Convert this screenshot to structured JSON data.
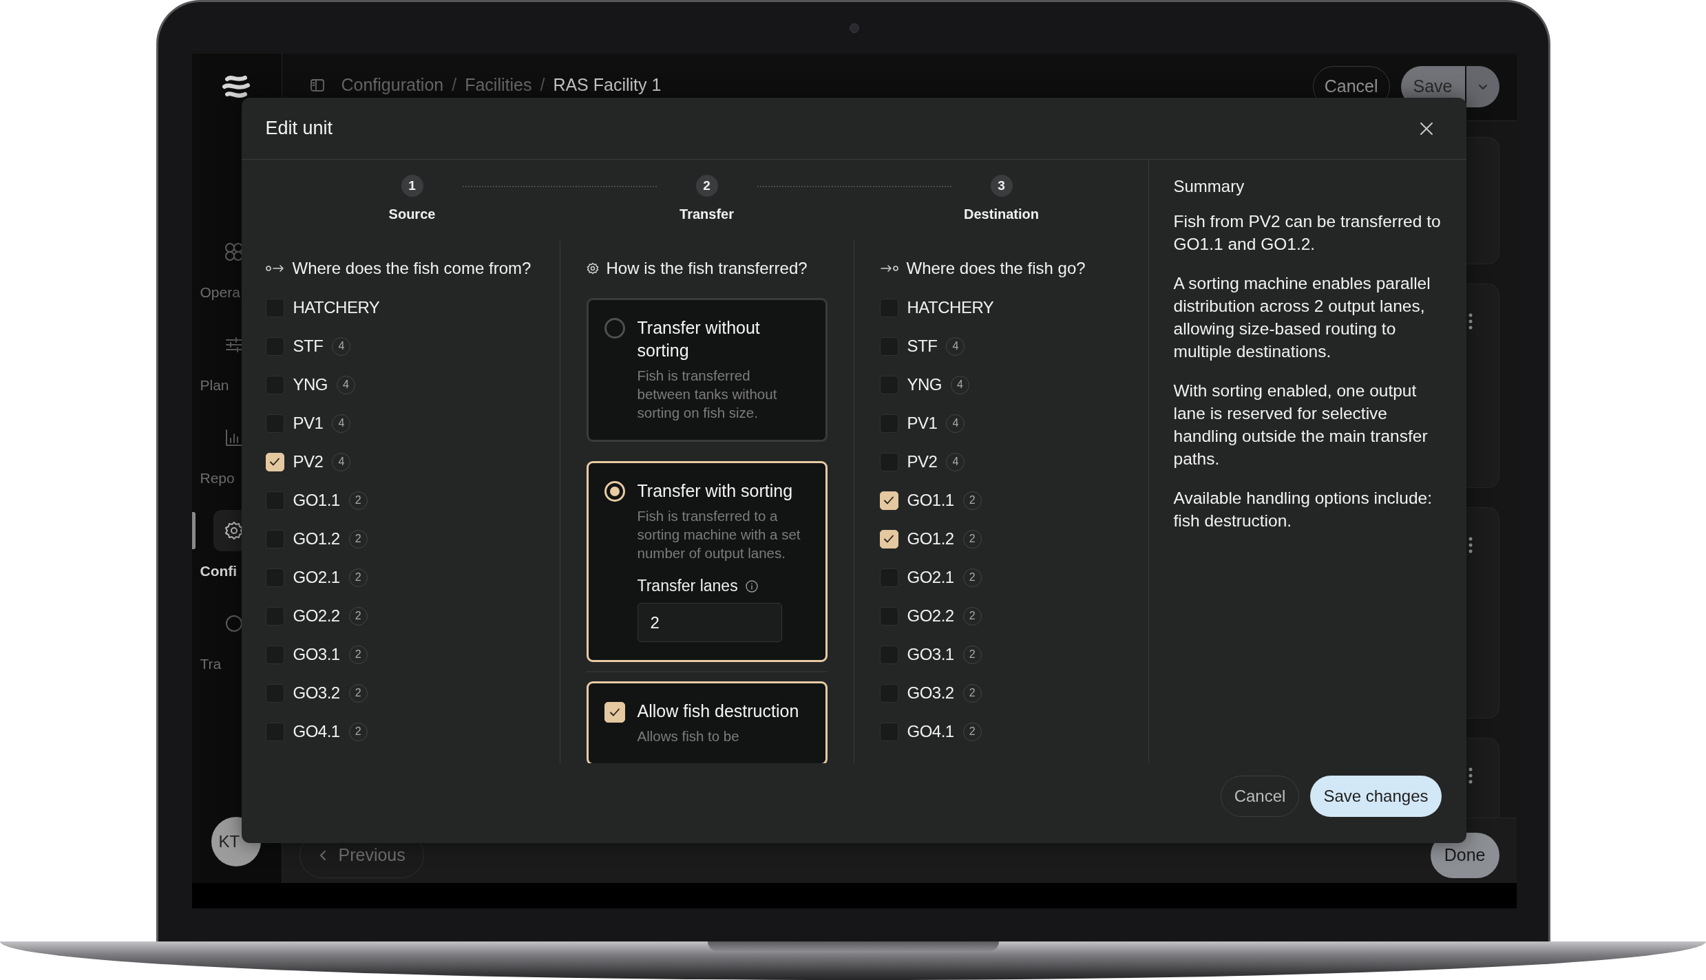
{
  "sidebar": {
    "items": [
      {
        "label": "Opera",
        "kind": "operations",
        "selected": false
      },
      {
        "label": "Plan",
        "kind": "planning",
        "selected": false
      },
      {
        "label": "Repo",
        "kind": "reports",
        "selected": false
      },
      {
        "label": "Confi",
        "kind": "settings",
        "selected": true
      },
      {
        "label": "Tra",
        "kind": "tracking",
        "selected": false
      }
    ],
    "user": {
      "initials": "KT"
    }
  },
  "breadcrumb": {
    "separator": "/",
    "items": [
      "Configuration",
      "Facilities",
      "RAS Facility 1"
    ]
  },
  "header_buttons": {
    "cancel": "Cancel",
    "save": "Save"
  },
  "footer": {
    "previous": "Previous",
    "done": "Done"
  },
  "modal": {
    "title": "Edit unit",
    "steps": [
      {
        "number": "1",
        "label": "Source"
      },
      {
        "number": "2",
        "label": "Transfer"
      },
      {
        "number": "3",
        "label": "Destination"
      }
    ],
    "source": {
      "heading": "Where does the fish come from?",
      "options": [
        {
          "label": "HATCHERY",
          "checked": false
        },
        {
          "label": "STF",
          "count": "4",
          "checked": false
        },
        {
          "label": "YNG",
          "count": "4",
          "checked": false
        },
        {
          "label": "PV1",
          "count": "4",
          "checked": false
        },
        {
          "label": "PV2",
          "count": "4",
          "checked": true
        },
        {
          "label": "GO1.1",
          "count": "2",
          "checked": false
        },
        {
          "label": "GO1.2",
          "count": "2",
          "checked": false
        },
        {
          "label": "GO2.1",
          "count": "2",
          "checked": false
        },
        {
          "label": "GO2.2",
          "count": "2",
          "checked": false
        },
        {
          "label": "GO3.1",
          "count": "2",
          "checked": false
        },
        {
          "label": "GO3.2",
          "count": "2",
          "checked": false
        },
        {
          "label": "GO4.1",
          "count": "2",
          "checked": false
        }
      ]
    },
    "transfer": {
      "heading": "How is the fish transferred?",
      "modes": [
        {
          "title": "Transfer without sorting",
          "description": "Fish is transferred between tanks without sorting on fish size.",
          "selected": false
        },
        {
          "title": "Transfer with sorting",
          "description": "Fish is transferred to a sorting machine with a set number of output lanes.",
          "selected": true,
          "field": {
            "label": "Transfer lanes",
            "value": "2"
          }
        }
      ],
      "options": [
        {
          "title": "Allow fish destruction",
          "description": "Allows fish to be",
          "checked": true
        }
      ]
    },
    "destination": {
      "heading": "Where does the fish go?",
      "options": [
        {
          "label": "HATCHERY",
          "checked": false
        },
        {
          "label": "STF",
          "count": "4",
          "checked": false
        },
        {
          "label": "YNG",
          "count": "4",
          "checked": false
        },
        {
          "label": "PV1",
          "count": "4",
          "checked": false
        },
        {
          "label": "PV2",
          "count": "4",
          "checked": false
        },
        {
          "label": "GO1.1",
          "count": "2",
          "checked": true
        },
        {
          "label": "GO1.2",
          "count": "2",
          "checked": true
        },
        {
          "label": "GO2.1",
          "count": "2",
          "checked": false
        },
        {
          "label": "GO2.2",
          "count": "2",
          "checked": false
        },
        {
          "label": "GO3.1",
          "count": "2",
          "checked": false
        },
        {
          "label": "GO3.2",
          "count": "2",
          "checked": false
        },
        {
          "label": "GO4.1",
          "count": "2",
          "checked": false
        }
      ]
    },
    "summary": {
      "title": "Summary",
      "paragraphs": [
        "Fish from PV2 can be transferred to GO1.1 and GO1.2.",
        "A sorting machine enables parallel distribution across 2 output lanes, allowing size-based routing to multiple destinations.",
        "With sorting enabled, one output lane is reserved for selective handling outside the main transfer paths.",
        "Available handling options include: fish destruction."
      ]
    },
    "buttons": {
      "cancel": "Cancel",
      "save": "Save changes"
    }
  }
}
